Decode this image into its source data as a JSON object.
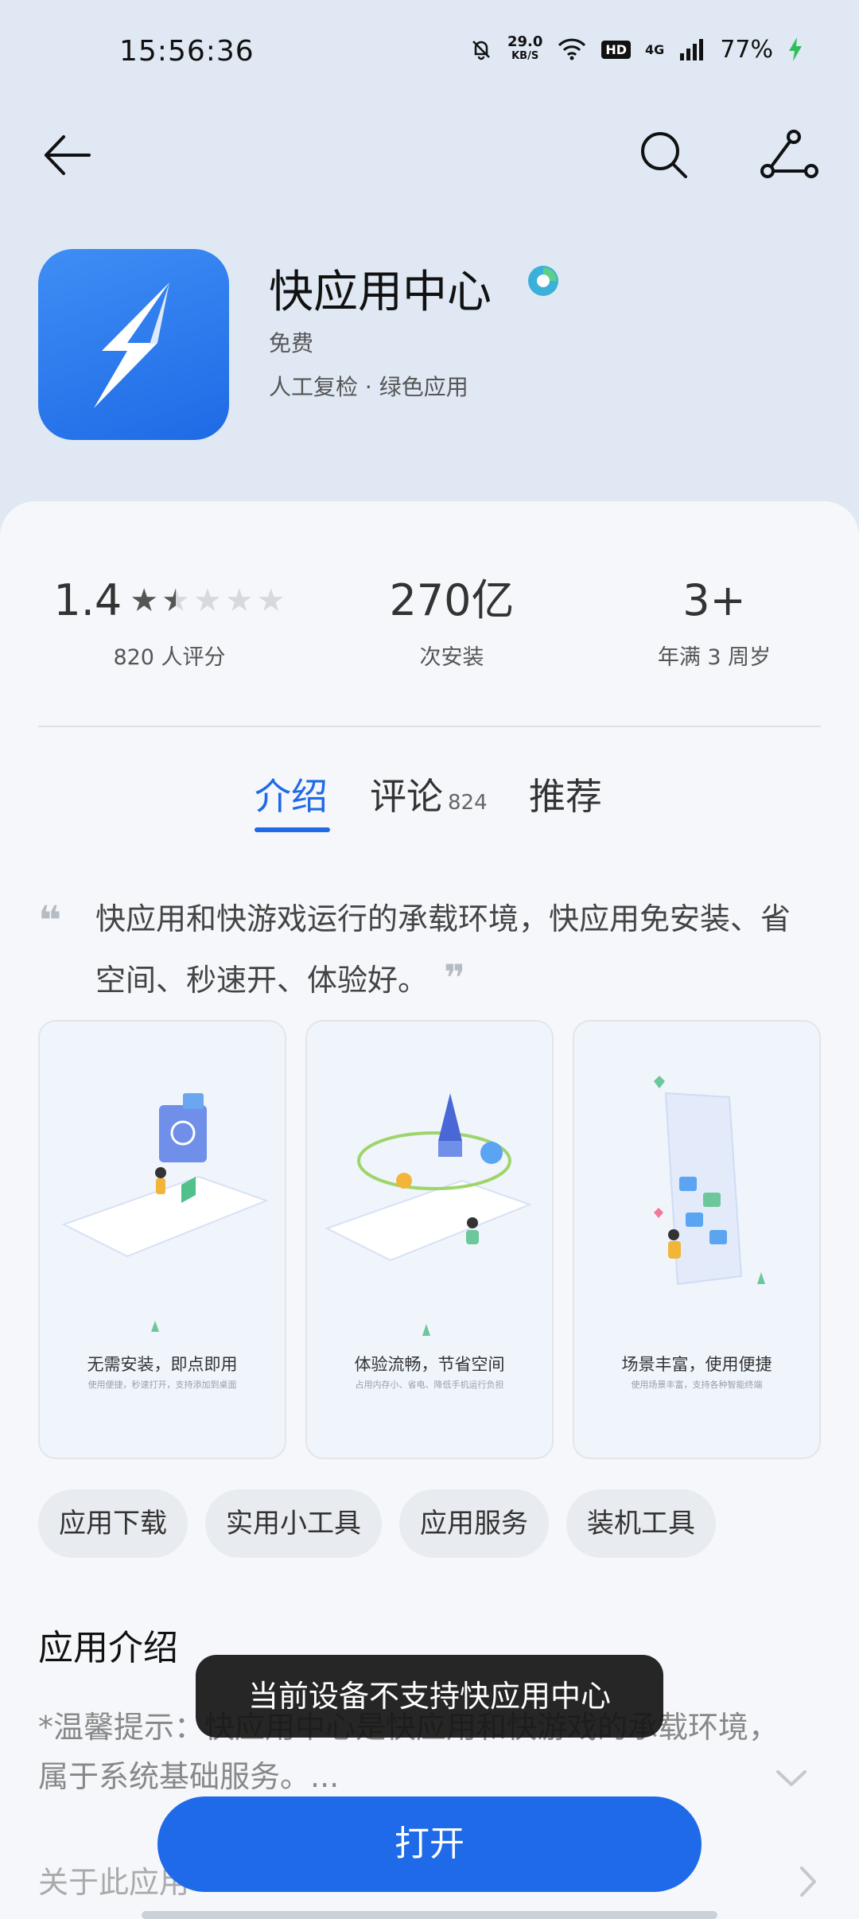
{
  "status": {
    "time": "15:56:36",
    "speed_value": "29.0",
    "speed_unit": "KB/S",
    "hd": "HD",
    "network": "4G",
    "battery": "77%"
  },
  "icons": {
    "back": "arrow-left-icon",
    "search": "search-icon",
    "share": "share-icon",
    "verified": "verified-badge-icon",
    "app": "lightning-bolt-icon",
    "quote_open": "quote-open-icon",
    "quote_close": "quote-close-icon",
    "expand": "chevron-down-icon",
    "more": "chevron-right-icon"
  },
  "app": {
    "name": "快应用中心",
    "price": "免费",
    "tags": "人工复检  ·  绿色应用"
  },
  "stats": {
    "rating": "1.4",
    "rating_value": 1.4,
    "rating_count": "820 人评分",
    "installs": "270亿",
    "installs_label": "次安装",
    "age": "3+",
    "age_label": "年满 3 周岁"
  },
  "tabs": [
    {
      "label": "介绍"
    },
    {
      "label": "评论",
      "count": "824"
    },
    {
      "label": "推荐"
    }
  ],
  "description": "快应用和快游戏运行的承载环境，快应用免安装、省空间、秒速开、体验好。",
  "screenshots": [
    {
      "title": "无需安装，即点即用",
      "subtitle": "使用便捷，秒速打开，支持添加到桌面"
    },
    {
      "title": "体验流畅，节省空间",
      "subtitle": "占用内存小、省电、降低手机运行负担"
    },
    {
      "title": "场景丰富，使用便捷",
      "subtitle": "使用场景丰富，支持各种智能终端"
    }
  ],
  "chips": [
    "应用下载",
    "实用小工具",
    "应用服务",
    "装机工具"
  ],
  "intro": {
    "title": "应用介绍",
    "text": "*温馨提示：快应用中心是快应用和快游戏的承载环境，属于系统基础服务。..."
  },
  "about": "关于此应用",
  "toast": "当前设备不支持快应用中心",
  "open_button": "打开",
  "colors": {
    "accent": "#1f6ae8",
    "background": "#dfe8f3",
    "card": "#f5f7fa"
  }
}
